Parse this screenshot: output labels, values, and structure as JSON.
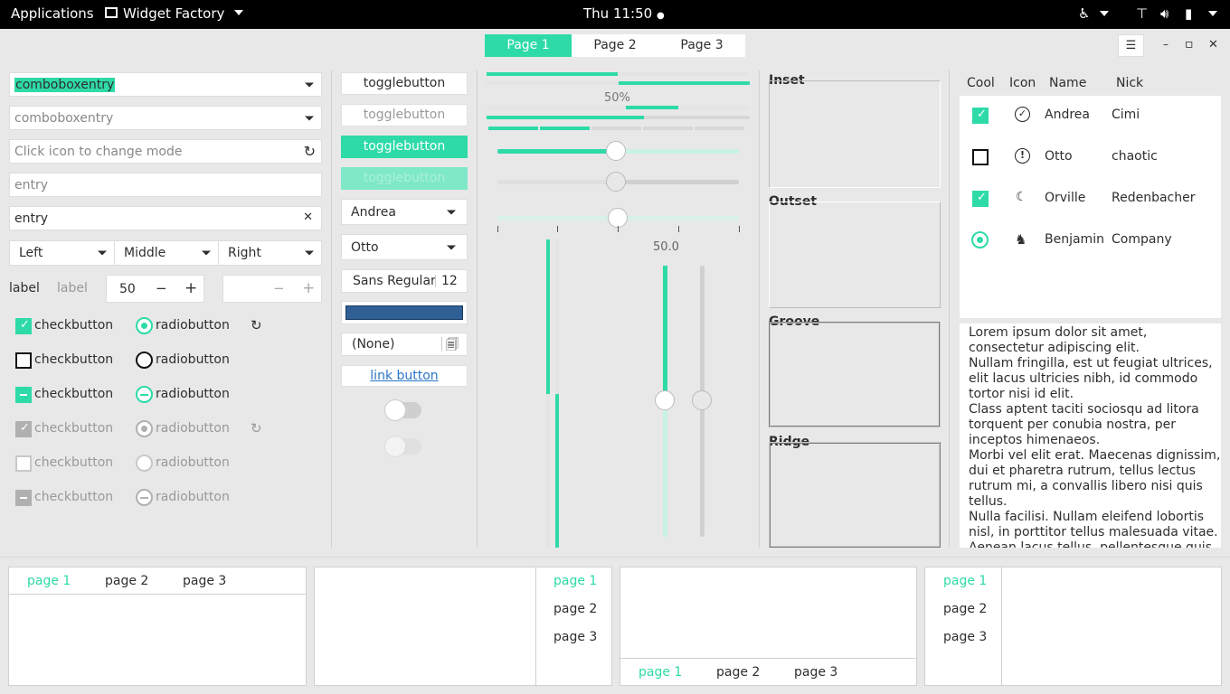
{
  "topbar": {
    "applications": "Applications",
    "app_name": "Widget Factory",
    "clock": "Thu 11:50",
    "clock_dot": "●"
  },
  "header": {
    "stack_tabs": [
      "Page 1",
      "Page 2",
      "Page 3"
    ],
    "menu_icon": "☰",
    "minimize": "–",
    "maximize": "▫",
    "close": "✕"
  },
  "col1": {
    "combo1": "comboboxentry",
    "combo2": "comboboxentry",
    "entry_mode_placeholder": "Click icon to change mode",
    "entry_placeholder": "entry",
    "entry_value": "entry",
    "clear_icon": "✕",
    "refresh_icon": "↻",
    "combos3": [
      "Left",
      "Middle",
      "Right"
    ],
    "label1": "label",
    "label2": "label",
    "spin_value": "50",
    "spin_minus": "−",
    "spin_plus": "+",
    "checks": [
      "checkbutton",
      "checkbutton",
      "checkbutton",
      "checkbutton",
      "checkbutton",
      "checkbutton"
    ],
    "radios": [
      "radiobutton",
      "radiobutton",
      "radiobutton",
      "radiobutton",
      "radiobutton",
      "radiobutton"
    ],
    "spinner_icon": "↻"
  },
  "col2": {
    "toggles": [
      "togglebutton",
      "togglebutton",
      "togglebutton",
      "togglebutton"
    ],
    "combo_andrea": "Andrea",
    "combo_otto": "Otto",
    "font_name": "Sans Regular",
    "font_size": "12",
    "color_value": "#2f5f95",
    "file_none": "(None)",
    "file_icon": "🗐",
    "link": "link button"
  },
  "col3": {
    "progress_label": "50%",
    "scale_value_h": "50.0",
    "progress_value": 0.5,
    "accent": "#2edaa8"
  },
  "frames": {
    "labels": [
      "Inset",
      "Outset",
      "Groove",
      "Ridge"
    ]
  },
  "tree": {
    "headers": [
      "Cool",
      "Icon",
      "Name",
      "Nick"
    ],
    "rows": [
      {
        "icon": "✓",
        "name": "Andrea",
        "nick": "Cimi"
      },
      {
        "icon": "!",
        "name": "Otto",
        "nick": "chaotic"
      },
      {
        "icon": "☾",
        "name": "Orville",
        "nick": "Redenbacher"
      },
      {
        "icon": "♞",
        "name": "Benjamin",
        "nick": "Company"
      }
    ]
  },
  "text_view": {
    "lines": [
      "Lorem ipsum dolor sit amet,",
      "consectetur adipiscing elit.",
      "Nullam fringilla, est ut feugiat ultrices,",
      "elit lacus ultricies nibh, id commodo",
      "tortor nisi id elit.",
      "Class aptent taciti sociosqu ad litora",
      "torquent per conubia nostra, per",
      "inceptos himenaeos.",
      "Morbi vel elit erat. Maecenas dignissim,",
      "dui et pharetra rutrum, tellus lectus",
      "rutrum mi, a convallis libero nisi quis",
      "tellus.",
      "Nulla facilisi. Nullam eleifend lobortis",
      "nisl, in porttitor tellus malesuada vitae.",
      "Aenean lacus tellus, pellentesque quis"
    ]
  },
  "notebooks": {
    "tabs": [
      "page 1",
      "page 2",
      "page 3"
    ]
  }
}
